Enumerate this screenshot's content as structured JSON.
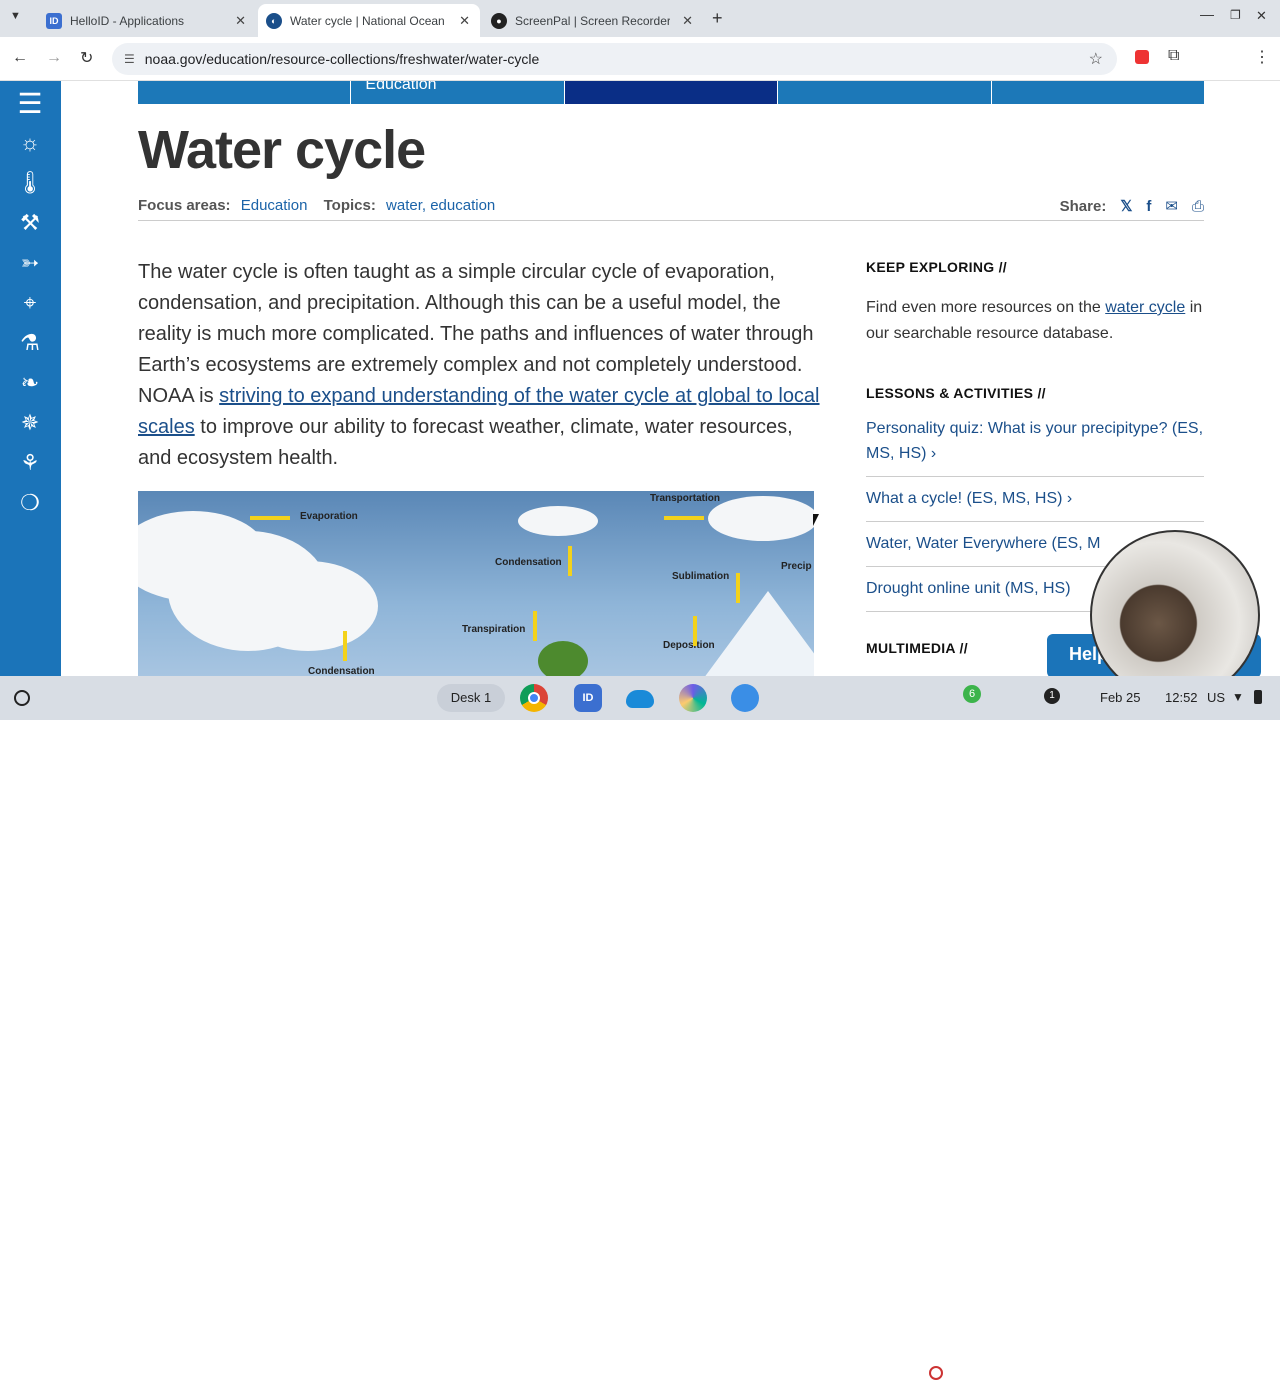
{
  "browser": {
    "tabs": [
      {
        "title": "HelloID - Applications",
        "icon": "id-icon"
      },
      {
        "title": "Water cycle | National Oceanic",
        "icon": "noaa-icon"
      },
      {
        "title": "ScreenPal | Screen Recorder & V",
        "icon": "screenpal-icon"
      }
    ],
    "url": "noaa.gov/education/resource-collections/freshwater/water-cycle"
  },
  "nav": {
    "items": [
      "",
      "Education",
      "",
      "",
      ""
    ]
  },
  "page": {
    "title": "Water cycle",
    "focus_label": "Focus areas:",
    "focus_value": "Education",
    "topics_label": "Topics:",
    "topics_value": "water, education",
    "share_label": "Share:",
    "intro_1": "The water cycle is often taught as a simple circular cycle of evaporation, condensation, and precipitation. Although this can be a useful model, the reality is much more complicated. The paths and influences of water through Earth’s ecosystems are extremely complex and not completely understood. NOAA is ",
    "intro_link": "striving to expand understanding of the water cycle at global to local scales",
    "intro_2": " to improve our ability to forecast weather, climate, water resources, and ecosystem health."
  },
  "figure": {
    "labels": [
      "Evaporation",
      "Transportation",
      "Condensation",
      "Sublimation",
      "Precip",
      "Transpiration",
      "Deposition",
      "Condensation"
    ]
  },
  "aside": {
    "keep_heading": "KEEP EXPLORING  //",
    "keep_text_1": "Find even more resources on the ",
    "keep_link": "water cycle",
    "keep_text_2": " in our searchable resource database.",
    "lessons_heading": "LESSONS & ACTIVITIES  //",
    "lessons": [
      "Personality quiz: What is your precipitype? (ES, MS, HS) ›",
      "What a cycle! (ES, MS, HS) ›",
      "Water, Water Everywhere (ES, M",
      "Drought online unit (MS, HS)"
    ],
    "multimedia_heading": "MULTIMEDIA  //"
  },
  "help_button": "Help",
  "shelf": {
    "desk": "Desk 1",
    "date": "Feb 25",
    "time": "12:52",
    "locale": "US",
    "notif_count": "1",
    "badge": "6"
  }
}
